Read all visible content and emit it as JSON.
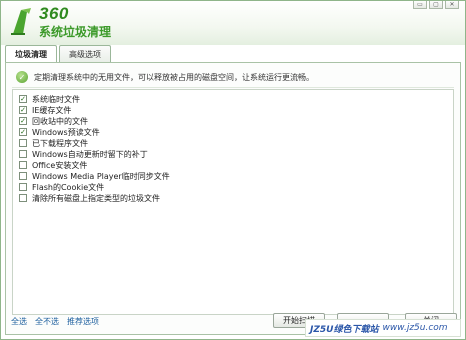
{
  "app": {
    "logo_number": "360",
    "title": "系统垃圾清理"
  },
  "window_controls": {
    "minimize": "▭",
    "maximize": "▢",
    "close": "✕"
  },
  "tabs": [
    {
      "label": "垃圾清理",
      "active": true
    },
    {
      "label": "高级选项",
      "active": false
    }
  ],
  "info_text": "定期清理系统中的无用文件，可以释放被占用的磁盘空间，让系统运行更流畅。",
  "items": [
    {
      "label": "系统临时文件",
      "checked": true
    },
    {
      "label": "IE缓存文件",
      "checked": true
    },
    {
      "label": "回收站中的文件",
      "checked": true
    },
    {
      "label": "Windows预读文件",
      "checked": true
    },
    {
      "label": "已下载程序文件",
      "checked": false
    },
    {
      "label": "Windows自动更新时留下的补丁",
      "checked": false
    },
    {
      "label": "Office安装文件",
      "checked": false
    },
    {
      "label": "Windows Media Player临时同步文件",
      "checked": false
    },
    {
      "label": "Flash的Cookie文件",
      "checked": false
    },
    {
      "label": "清除所有磁盘上指定类型的垃圾文件",
      "checked": false
    }
  ],
  "bottom_links": [
    "全选",
    "全不选",
    "推荐选项"
  ],
  "buttons": {
    "start": "开始扫描",
    "middle": "",
    "right": "关闭"
  },
  "watermark": {
    "text": "JZ5U绿色下载站",
    "url": "www.jz5u.com"
  },
  "colors": {
    "brand_green": "#3c9a2a",
    "border_green": "#9bb79a",
    "link_blue": "#1d5f9e"
  }
}
